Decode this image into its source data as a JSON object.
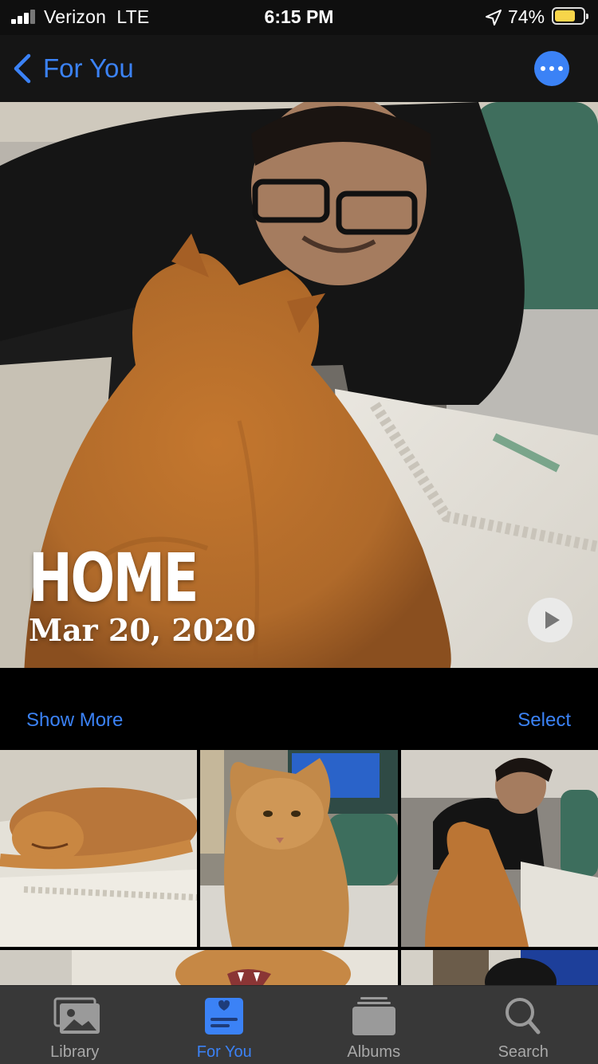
{
  "status_bar": {
    "carrier": "Verizon",
    "network": "LTE",
    "time": "6:15 PM",
    "battery_percent": "74%",
    "battery_level": 0.74,
    "battery_color": "#f7d54a"
  },
  "nav": {
    "back_label": "For You",
    "more_icon": "ellipsis-icon",
    "accent_color": "#3b82f6"
  },
  "memory": {
    "title": "HOME",
    "date": "Mar 20, 2020",
    "play_icon": "play-icon"
  },
  "actions": {
    "show_more": "Show More",
    "select": "Select"
  },
  "photos": [
    "sleeping-cat-photo",
    "sitting-cat-photo",
    "man-with-cat-photo",
    "cat-yawning-photo",
    "man-with-monitor-photo"
  ],
  "tabs": [
    {
      "label": "Library",
      "icon": "photo-library-icon",
      "active": false
    },
    {
      "label": "For You",
      "icon": "for-you-icon",
      "active": true
    },
    {
      "label": "Albums",
      "icon": "albums-icon",
      "active": false
    },
    {
      "label": "Search",
      "icon": "search-icon",
      "active": false
    }
  ]
}
